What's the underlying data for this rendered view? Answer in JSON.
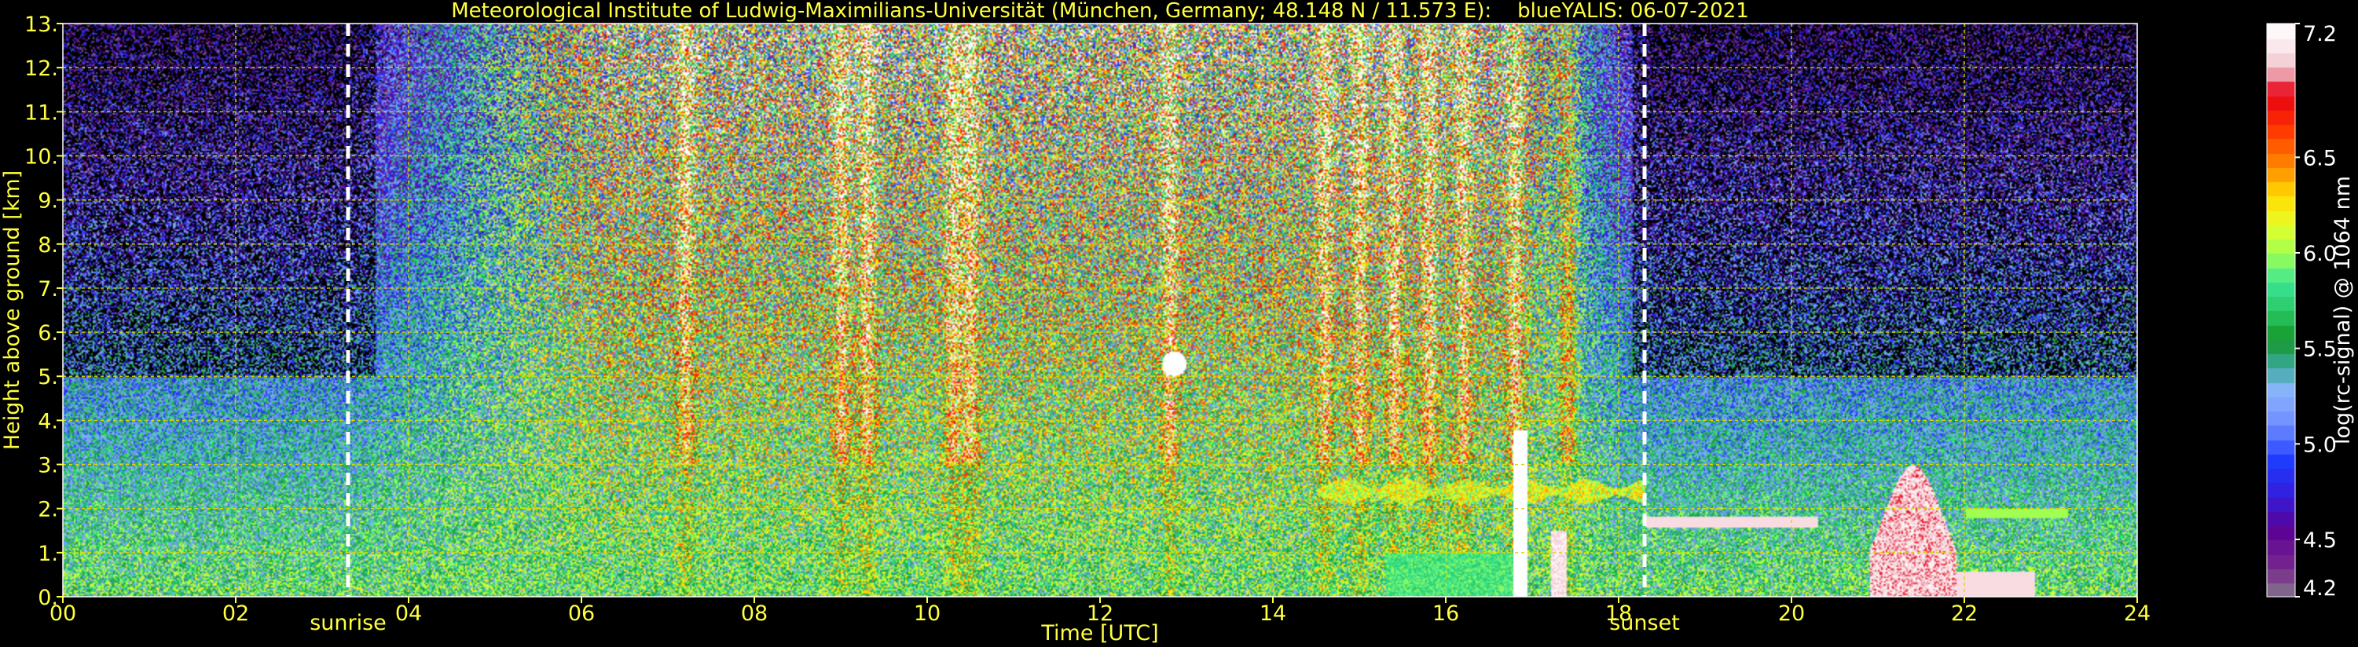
{
  "chart_data": {
    "type": "heatmap",
    "title": "Meteorological Institute of Ludwig-Maximilians-Universität (München, Germany; 48.148 N / 11.573 E):    blueYALIS: 06-07-2021",
    "xlabel": "Time [UTC]",
    "ylabel": "Height above ground [km]",
    "xlim": [
      0,
      24
    ],
    "ylim": [
      0,
      13
    ],
    "x_ticks": [
      "00",
      "02",
      "04",
      "06",
      "08",
      "10",
      "12",
      "14",
      "16",
      "18",
      "20",
      "22",
      "24"
    ],
    "y_ticks": [
      "0.",
      "1.",
      "2.",
      "3.",
      "4.",
      "5.",
      "6.",
      "7.",
      "8.",
      "9.",
      "10.",
      "11.",
      "12.",
      "13."
    ],
    "grid": true,
    "annotations": [
      {
        "label": "sunrise",
        "x": 3.3
      },
      {
        "label": "sunset",
        "x": 18.3
      }
    ],
    "colorbar": {
      "label": "log(rc-signal) @ 1064 nm",
      "range": [
        4.2,
        7.2
      ],
      "ticks": [
        "4.2",
        "4.5",
        "5.0",
        "5.5",
        "6.0",
        "6.5",
        "7.2"
      ]
    }
  },
  "colors": {
    "text": "#ffff40",
    "grid": "#d8d800",
    "background": "#000000",
    "annotation_line": "#ffffff"
  }
}
